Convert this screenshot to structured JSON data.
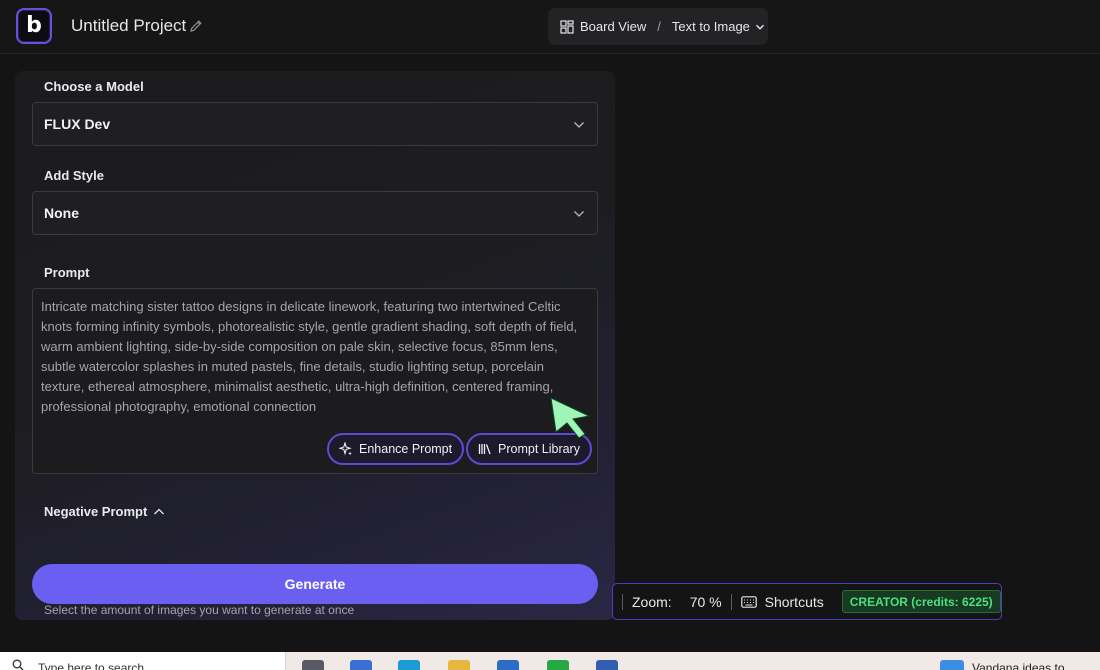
{
  "header": {
    "logo_letter": "b",
    "project_title": "Untitled Project",
    "view_label": "Board View",
    "separator": "/",
    "mode_label": "Text to Image"
  },
  "panel": {
    "model_label": "Choose a Model",
    "model_value": "FLUX Dev",
    "style_label": "Add Style",
    "style_value": "None",
    "prompt_label": "Prompt",
    "prompt_text": "Intricate matching sister tattoo designs in delicate linework, featuring two intertwined Celtic knots forming infinity symbols, photorealistic style, gentle gradient shading, soft depth of field, warm ambient lighting, side-by-side composition on pale skin, selective focus, 85mm lens, subtle watercolor splashes in muted pastels, fine details, studio lighting setup, porcelain texture, ethereal atmosphere, minimalist aesthetic, ultra-high definition, centered framing, professional photography, emotional connection",
    "enhance_label": "Enhance Prompt",
    "library_label": "Prompt Library",
    "negative_label": "Negative Prompt",
    "generate_label": "Generate",
    "hint": "Select the amount of images you want to generate at once"
  },
  "statusbar": {
    "zoom_label": "Zoom:",
    "zoom_value": "70 %",
    "shortcuts_label": "Shortcuts",
    "credits_label": "CREATOR (credits: 6225)"
  },
  "taskbar": {
    "search_placeholder": "Type here to search",
    "right_text": "Vandana ideas to"
  },
  "colors": {
    "accent": "#6a5ff0",
    "pill_border": "#5b4bd6",
    "credits_green": "#4fe07e",
    "cursor_green": "#9ff5b8"
  }
}
